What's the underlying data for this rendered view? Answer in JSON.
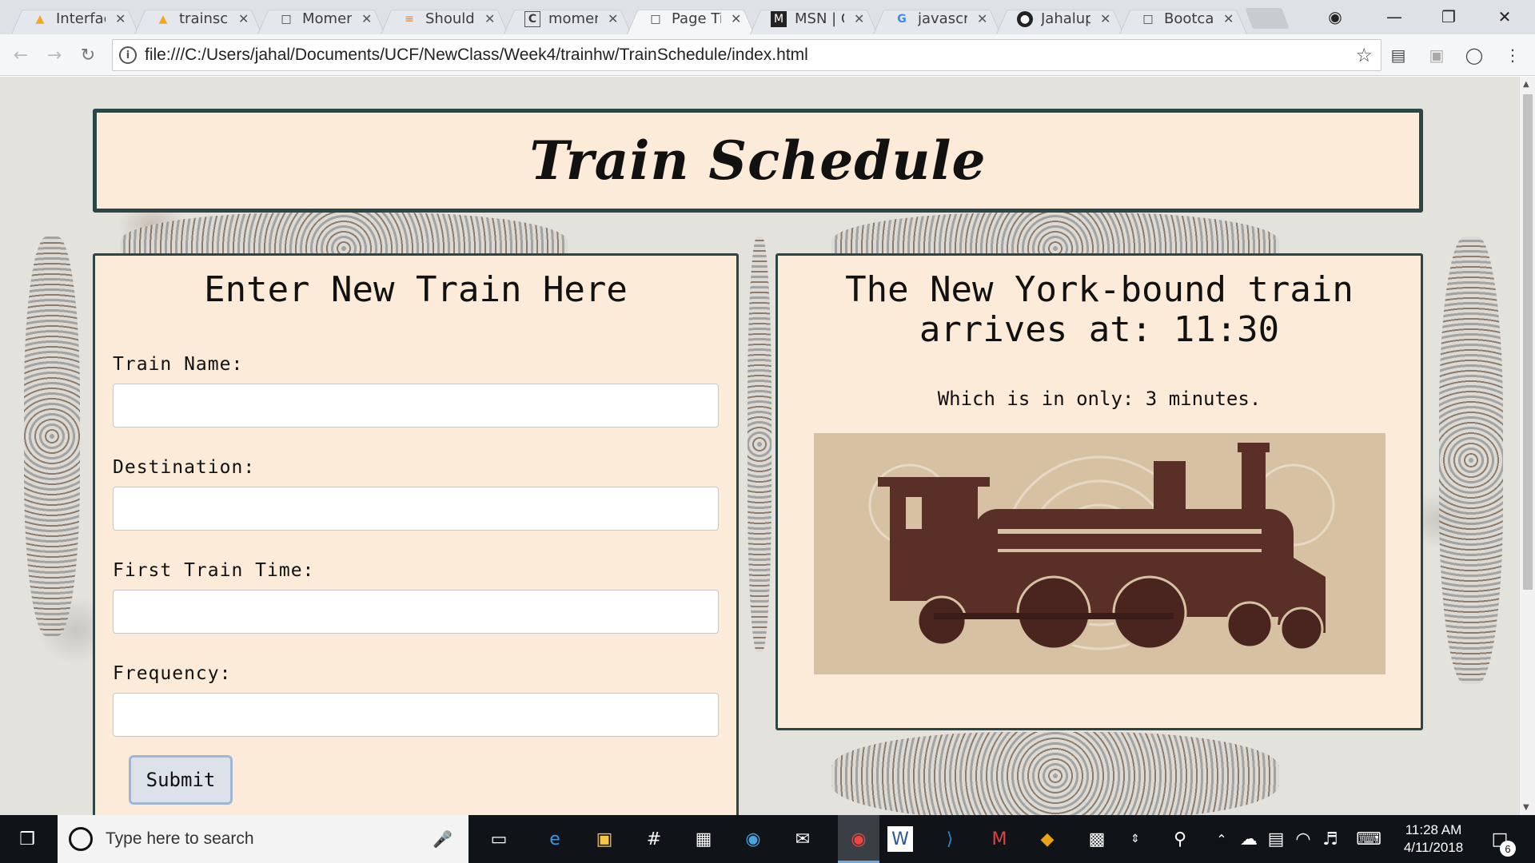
{
  "browser": {
    "tabs": [
      {
        "title": "Interface",
        "icon": "firebase-icon"
      },
      {
        "title": "trainsch",
        "icon": "firebase-icon"
      },
      {
        "title": "Momen",
        "icon": "page-icon"
      },
      {
        "title": "Should",
        "icon": "stackoverflow-icon"
      },
      {
        "title": "momen",
        "icon": "letter-c-icon"
      },
      {
        "title": "Page Ti",
        "icon": "page-icon"
      },
      {
        "title": "MSN | C",
        "icon": "msn-icon"
      },
      {
        "title": "javascri",
        "icon": "google-icon"
      },
      {
        "title": "Jahalup",
        "icon": "github-icon"
      },
      {
        "title": "Bootcar",
        "icon": "page-icon"
      }
    ],
    "active_tab_index": 5,
    "url": "file:///C:/Users/jahal/Documents/UCF/NewClass/Week4/trainhw/TrainSchedule/index.html"
  },
  "page": {
    "title": "Train Schedule",
    "form": {
      "heading": "Enter New Train Here",
      "fields": [
        {
          "label": "Train Name:",
          "value": ""
        },
        {
          "label": "Destination:",
          "value": ""
        },
        {
          "label": "First Train Time:",
          "value": ""
        },
        {
          "label": "Frequency:",
          "value": ""
        }
      ],
      "submit_label": "Submit"
    },
    "arrival": {
      "heading_line1": "The New York-bound train",
      "heading_line2": "arrives at: 11:30",
      "wait_text": "Which is in only: 3 minutes."
    }
  },
  "taskbar": {
    "search_placeholder": "Type here to search",
    "time": "11:28 AM",
    "date": "4/11/2018",
    "notification_count": "6",
    "colors": {
      "background": "#101418",
      "accent": "#6fa8dc"
    }
  },
  "colors": {
    "panel_bg": "#fbebd8",
    "panel_border": "#2c4545",
    "page_bg": "#e4e2dc"
  }
}
